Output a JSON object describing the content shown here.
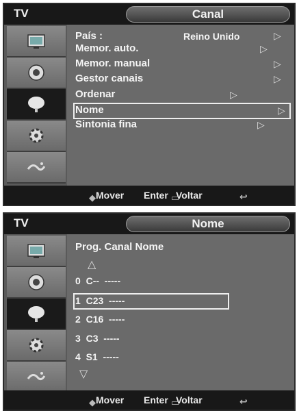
{
  "menu_screen": {
    "tv_label": "TV",
    "title": "Canal",
    "items": [
      {
        "label": "País  :",
        "value": "Reino Unido"
      },
      {
        "label": "Memor. auto."
      },
      {
        "label": "Memor. manual"
      },
      {
        "label": "Gestor canais"
      },
      {
        "label": "Ordenar"
      },
      {
        "label": "Nome"
      },
      {
        "label": "Sintonia fina"
      }
    ],
    "selected_item": "Nome",
    "footer": {
      "move": "Mover",
      "enter": "Enter",
      "back": "Voltar"
    }
  },
  "name_screen": {
    "tv_label": "TV",
    "title": "Nome",
    "columns": "Prog.  Canal  Nome",
    "rows": [
      {
        "prog": "0",
        "channel": "C--",
        "name": "-----"
      },
      {
        "prog": "1",
        "channel": "C23",
        "name": "-----"
      },
      {
        "prog": "2",
        "channel": "C16",
        "name": "-----"
      },
      {
        "prog": "3",
        "channel": "C3",
        "name": "-----"
      },
      {
        "prog": "4",
        "channel": "S1",
        "name": "-----"
      }
    ],
    "selected_prog": "1",
    "footer": {
      "move": "Mover",
      "enter": "Enter",
      "back": "Voltar"
    }
  },
  "sidebar_icons": [
    "picture-icon",
    "sound-icon",
    "channel-icon",
    "setup-icon",
    "input-icon"
  ],
  "arrow_glyph": "▷",
  "up_glyph": "△",
  "down_glyph": "▽"
}
